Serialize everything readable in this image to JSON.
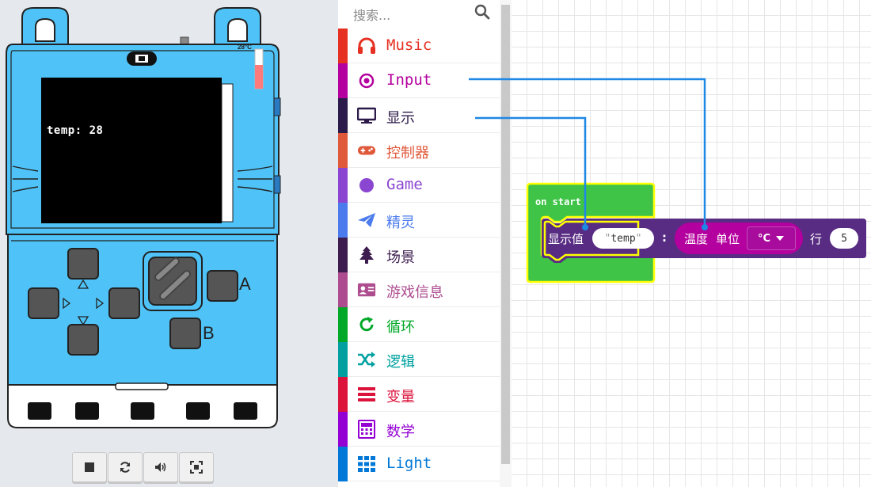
{
  "simulator": {
    "screen_text": "temp: 28",
    "temperature_label": "28°C",
    "temperature_level": 0.28,
    "button_a": "A",
    "button_b": "B",
    "toolbar": [
      "stop-icon",
      "restart-icon",
      "sound-icon",
      "fullscreen-icon"
    ]
  },
  "toolbox": {
    "search_placeholder": "搜索...",
    "categories": [
      {
        "label": "Music",
        "color": "#e63022",
        "icon": "headphones-icon"
      },
      {
        "label": "Input",
        "color": "#b4009e",
        "icon": "radio-target-icon"
      },
      {
        "label": "显示",
        "color": "#2c1a4a",
        "icon": "monitor-icon"
      },
      {
        "label": "控制器",
        "color": "#e0593b",
        "icon": "gamepad-icon"
      },
      {
        "label": "Game",
        "color": "#8b46d1",
        "icon": "circle-icon"
      },
      {
        "label": "精灵",
        "color": "#4b7bec",
        "icon": "paper-plane-icon"
      },
      {
        "label": "场景",
        "color": "#3d1d4f",
        "icon": "tree-icon"
      },
      {
        "label": "游戏信息",
        "color": "#ad4d8f",
        "icon": "id-card-icon"
      },
      {
        "label": "循环",
        "color": "#00a827",
        "icon": "refresh-icon"
      },
      {
        "label": "逻辑",
        "color": "#00a0a0",
        "icon": "shuffle-icon"
      },
      {
        "label": "变量",
        "color": "#dc143c",
        "icon": "list-icon"
      },
      {
        "label": "数学",
        "color": "#9400d3",
        "icon": "calculator-icon"
      },
      {
        "label": "Light",
        "color": "#0078d7",
        "icon": "grid-icon"
      }
    ]
  },
  "workspace": {
    "on_start_label": "on start",
    "show_value_label": "显示值",
    "string_value": "temp",
    "colon": ":",
    "temperature_label": "温度",
    "unit_label": "单位",
    "unit_value": "°C",
    "row_label": "行",
    "row_value": "5",
    "colors": {
      "loops": "#3fc447",
      "display": "#582c83",
      "input": "#b4009e",
      "highlight": "#ffff00",
      "wire": "#1e88e5"
    }
  }
}
